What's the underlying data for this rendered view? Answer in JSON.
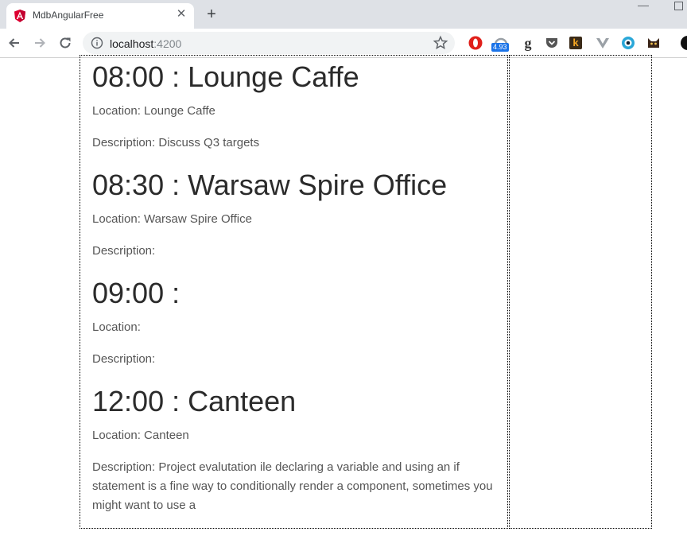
{
  "browser": {
    "tab_title": "MdbAngularFree",
    "url_host": "localhost",
    "url_port": ":4200",
    "extension_badge": "4.93",
    "ext_g_label": "g",
    "ext_k_label": "k"
  },
  "events": [
    {
      "heading": "08:00 : Lounge Caffe",
      "location": "Location: Lounge Caffe",
      "description": "Description: Discuss Q3 targets"
    },
    {
      "heading": "08:30 : Warsaw Spire Office",
      "location": "Location: Warsaw Spire Office",
      "description": "Description:"
    },
    {
      "heading": "09:00 :",
      "location": "Location:",
      "description": "Description:"
    },
    {
      "heading": "12:00 : Canteen",
      "location": "Location: Canteen",
      "description": "Description: Project evalutation ile declaring a variable and using an if statement is a fine way to conditionally render a component, sometimes you might want to use a"
    }
  ]
}
